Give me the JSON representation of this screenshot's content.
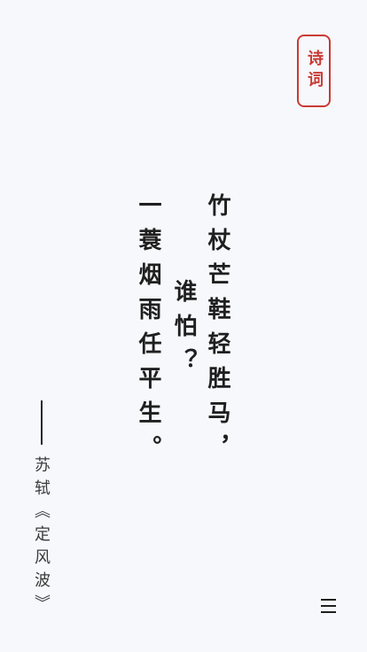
{
  "header": {
    "category_label": "诗词"
  },
  "poem": {
    "lines": [
      "竹杖芒鞋轻胜马，",
      "谁怕？",
      "一蓑烟雨任平生。"
    ]
  },
  "attribution": {
    "text": "苏轼《定风波》"
  },
  "menu": {
    "icon": "hamburger-menu-icon"
  }
}
